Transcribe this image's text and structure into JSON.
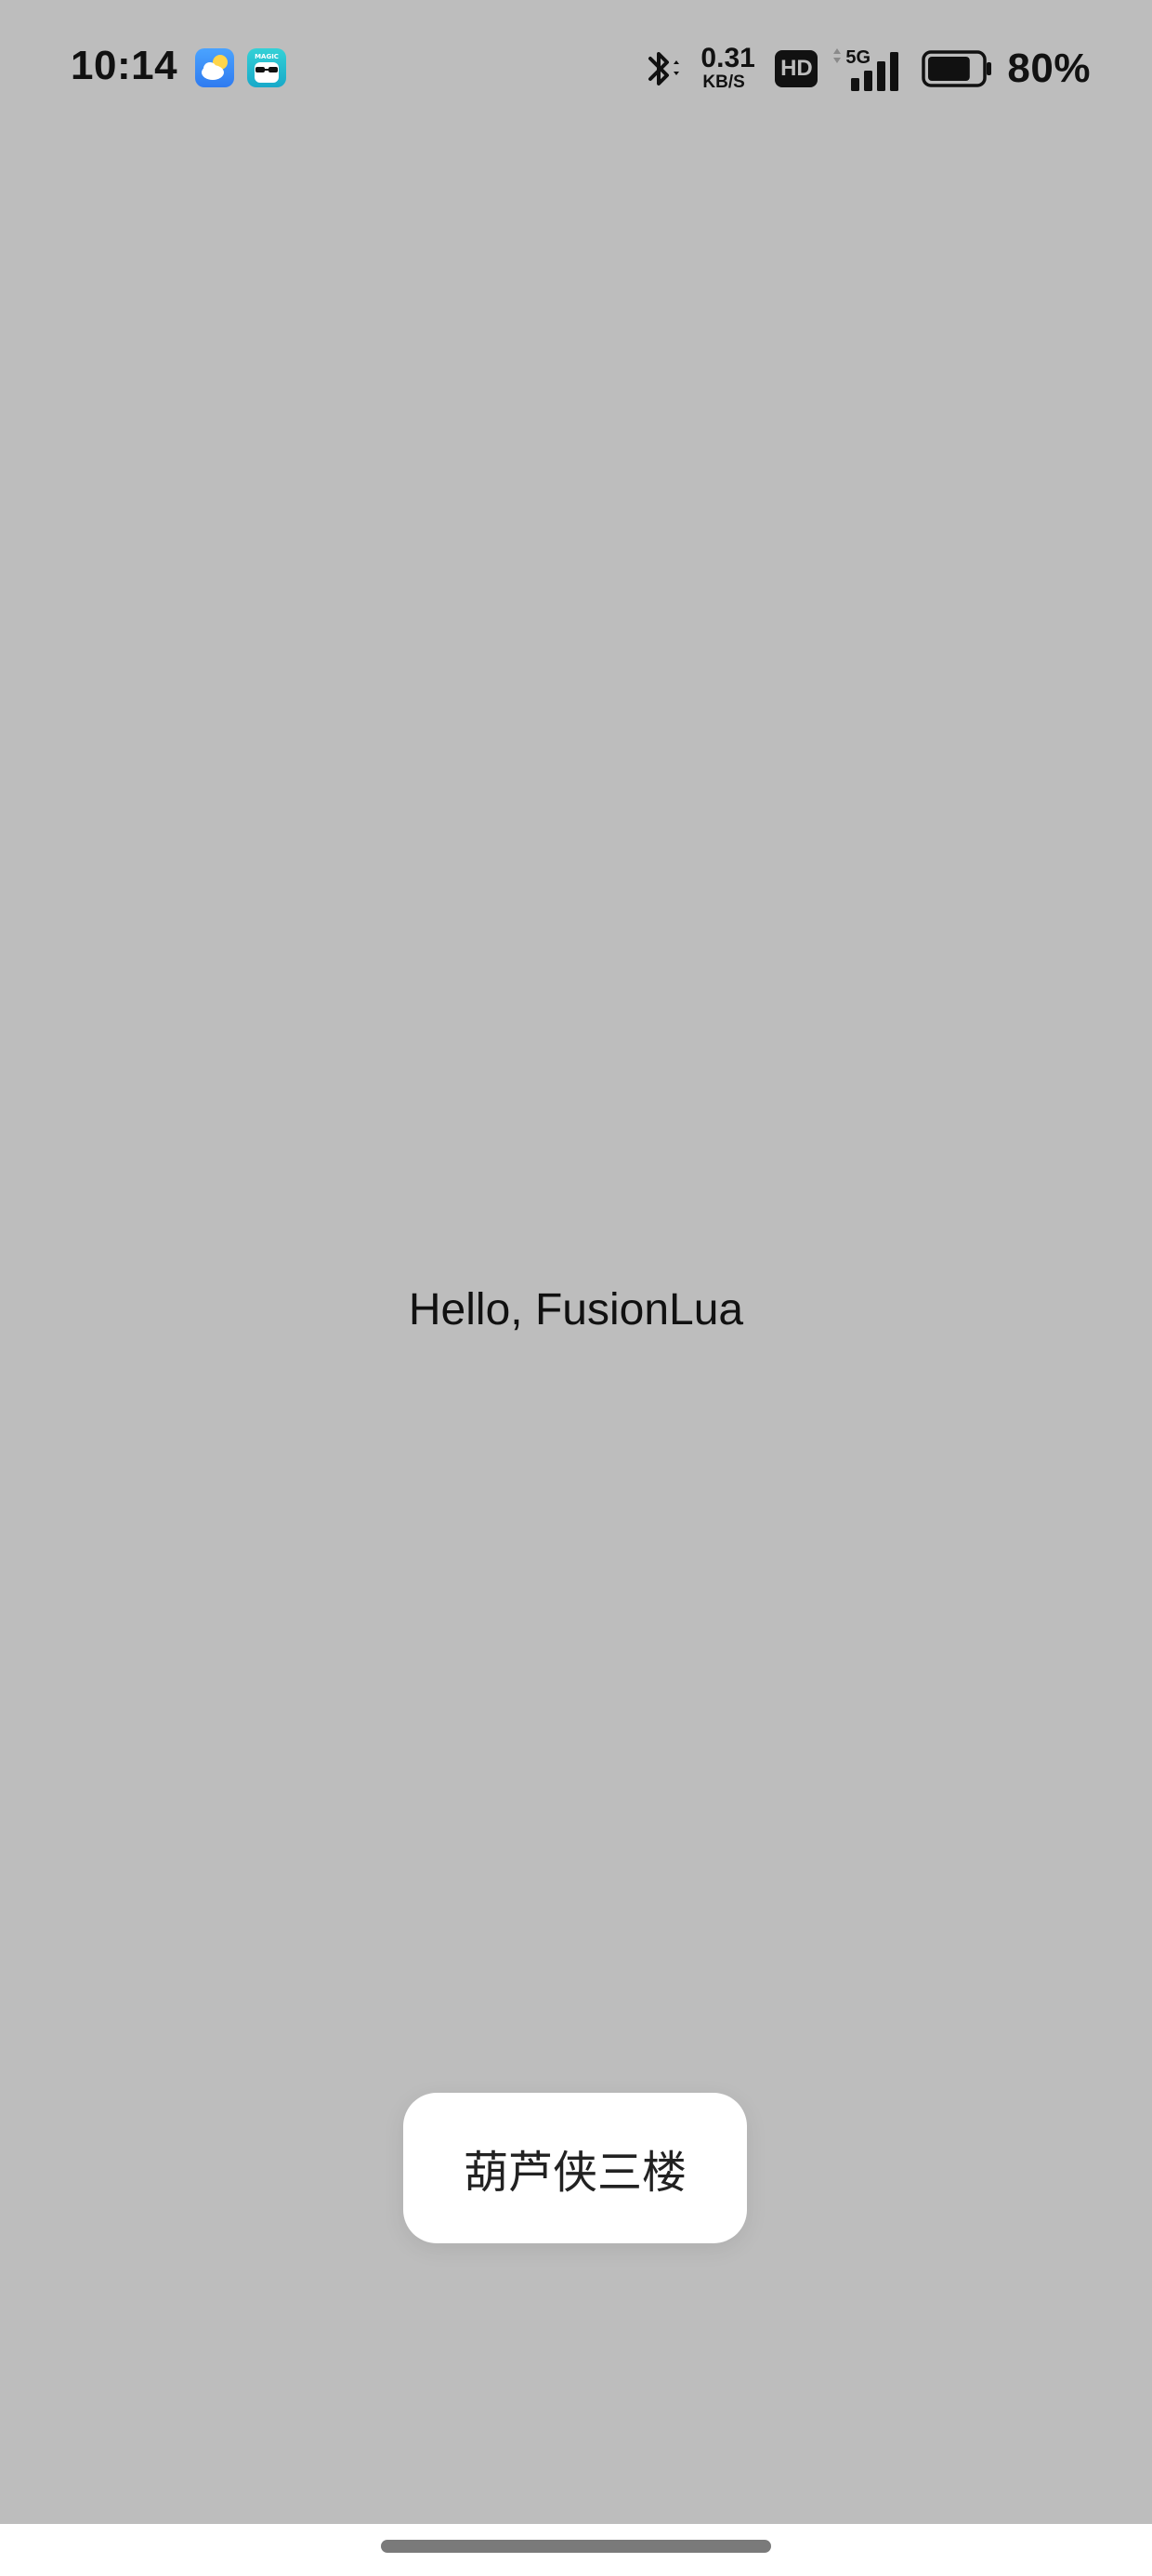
{
  "status_bar": {
    "time": "10:14",
    "notification_icons": [
      "weather-icon",
      "magic-app-icon"
    ],
    "magic_icon_text": "MAGIC",
    "bluetooth": "bluetooth-icon",
    "net_speed_value": "0.31",
    "net_speed_unit": "KB/S",
    "hd_label": "HD",
    "network_label": "5G",
    "signal_strength_bars": 4,
    "battery_level": 0.8,
    "battery_text": "80%"
  },
  "main": {
    "greeting": "Hello, FusionLua"
  },
  "toast": {
    "message": "葫芦侠三楼"
  },
  "colors": {
    "background": "#bdbdbd",
    "toast_background": "#ffffff",
    "text": "#111111",
    "home_indicator": "#7a7a7a"
  }
}
